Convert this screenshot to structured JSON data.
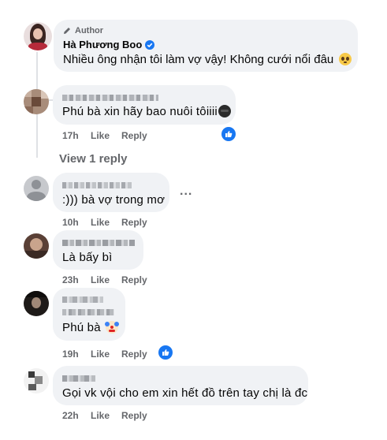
{
  "comments": [
    {
      "author_badge": "Author",
      "name": "Hà Phương Boo",
      "text": "Nhiều ông nhận tôi làm vợ vậy! Không cưới nổi đâu",
      "emoji": "pleading-face"
    },
    {
      "text": "Phú bà xin hãy bao nuôi tôiiii",
      "time": "17h",
      "like": "Like",
      "reply": "Reply"
    },
    {
      "text": ":))) bà vợ trong mơ",
      "time": "10h",
      "like": "Like",
      "reply": "Reply"
    },
    {
      "text": "Là bấy bì",
      "time": "23h",
      "like": "Like",
      "reply": "Reply"
    },
    {
      "text": "Phú bà",
      "emoji": "clown-face",
      "time": "19h",
      "like": "Like",
      "reply": "Reply"
    },
    {
      "text": "Gọi vk vội cho em xin hết đồ trên tay chị là đc",
      "time": "22h",
      "like": "Like",
      "reply": "Reply"
    }
  ],
  "view_replies": "View 1 reply",
  "more_dots": "...",
  "colors": {
    "bubble": "#f0f2f5",
    "meta": "#65676b",
    "like_blue": "#1877f2",
    "thread_line": "#dfe1e5"
  }
}
